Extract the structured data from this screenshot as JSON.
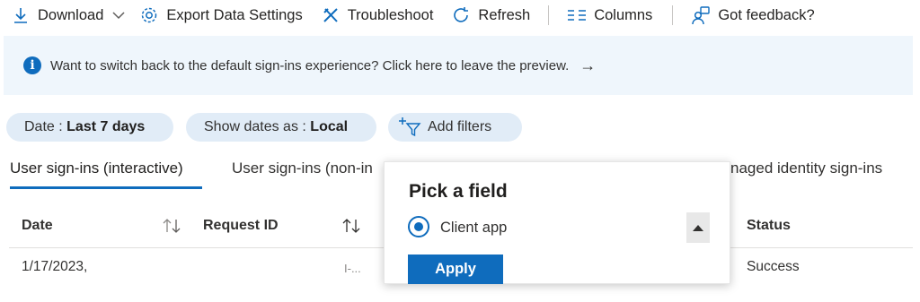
{
  "toolbar": {
    "download": "Download",
    "export": "Export Data Settings",
    "troubleshoot": "Troubleshoot",
    "refresh": "Refresh",
    "columns": "Columns",
    "feedback": "Got feedback?"
  },
  "banner": {
    "text": "Want to switch back to the default sign-ins experience? Click here to leave the preview.",
    "arrow": "→"
  },
  "filters": {
    "date_label": "Date : ",
    "date_value": "Last 7 days",
    "show_dates_label": "Show dates as : ",
    "show_dates_value": "Local",
    "add_filters": "Add filters"
  },
  "tabs": [
    "User sign-ins (interactive)",
    "User sign-ins (non-in",
    "naged identity sign-ins"
  ],
  "grid": {
    "columns": [
      "Date",
      "Request ID",
      "Status"
    ],
    "rows": [
      {
        "date": "1/17/2023, ",
        "request_id": "I-...",
        "status": "Success"
      }
    ]
  },
  "popup": {
    "title": "Pick a field",
    "option": "Client app",
    "apply": "Apply"
  },
  "colors": {
    "accent": "#0f6cbd",
    "pill_bg": "#e1ecf7",
    "banner_bg": "#eff6fc"
  }
}
